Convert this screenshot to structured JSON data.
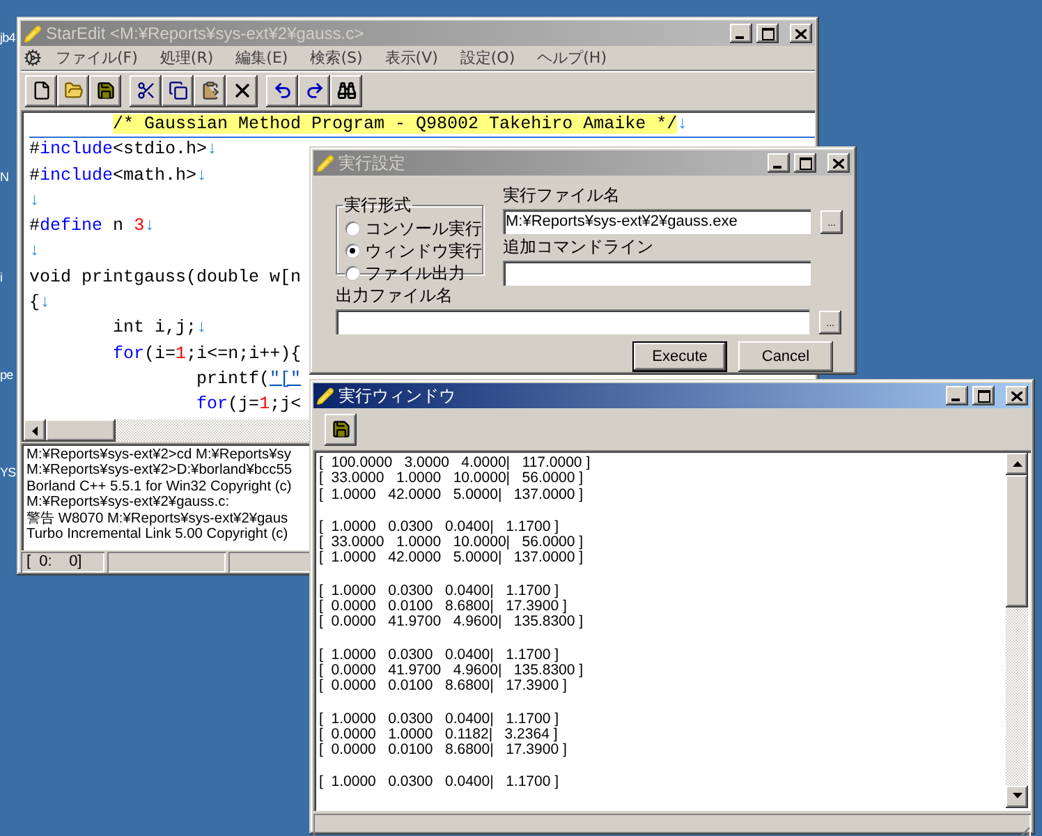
{
  "desktop": {
    "icon_labels": [
      "jb4",
      "N",
      "i",
      "pe",
      "YS"
    ]
  },
  "editor_window": {
    "title": "StarEdit <M:¥Reports¥sys-ext¥2¥gauss.c>",
    "active": false,
    "menu": [
      "ファイル(F)",
      "処理(R)",
      "編集(E)",
      "検索(S)",
      "表示(V)",
      "設定(O)",
      "ヘルプ(H)"
    ],
    "code_lines": [
      {
        "current": true,
        "tokens": [
          {
            "kind": "comment",
            "text": "        /* Gaussian Method Program - Q98002 Takehiro Amaike */"
          },
          {
            "kind": "mark",
            "text": "↓"
          }
        ]
      },
      {
        "current": false,
        "tokens": [
          {
            "kind": "plain",
            "text": "#"
          },
          {
            "kind": "keyword",
            "text": "include"
          },
          {
            "kind": "plain",
            "text": "<stdio.h>"
          },
          {
            "kind": "mark",
            "text": "↓"
          }
        ]
      },
      {
        "current": false,
        "tokens": [
          {
            "kind": "plain",
            "text": "#"
          },
          {
            "kind": "keyword",
            "text": "include"
          },
          {
            "kind": "plain",
            "text": "<math.h>"
          },
          {
            "kind": "mark",
            "text": "↓"
          }
        ]
      },
      {
        "current": false,
        "tokens": [
          {
            "kind": "mark",
            "text": "↓"
          }
        ]
      },
      {
        "current": false,
        "tokens": [
          {
            "kind": "plain",
            "text": "#"
          },
          {
            "kind": "keyword",
            "text": "define"
          },
          {
            "kind": "plain",
            "text": " n "
          },
          {
            "kind": "number",
            "text": "3"
          },
          {
            "kind": "mark",
            "text": "↓"
          }
        ]
      },
      {
        "current": false,
        "tokens": [
          {
            "kind": "mark",
            "text": "↓"
          }
        ]
      },
      {
        "current": false,
        "tokens": [
          {
            "kind": "plain",
            "text": "void printgauss(double w[n"
          }
        ]
      },
      {
        "current": false,
        "tokens": [
          {
            "kind": "plain",
            "text": "{"
          },
          {
            "kind": "mark",
            "text": "↓"
          }
        ]
      },
      {
        "current": false,
        "tokens": [
          {
            "kind": "plain",
            "text": "        int i,j;"
          },
          {
            "kind": "mark",
            "text": "↓"
          }
        ]
      },
      {
        "current": false,
        "tokens": [
          {
            "kind": "keyword",
            "text": "        for"
          },
          {
            "kind": "plain",
            "text": "(i="
          },
          {
            "kind": "number",
            "text": "1"
          },
          {
            "kind": "plain",
            "text": ";i<=n;i++){"
          }
        ]
      },
      {
        "current": false,
        "tokens": [
          {
            "kind": "plain",
            "text": "                printf("
          },
          {
            "kind": "string",
            "text": "\"[\""
          }
        ]
      },
      {
        "current": false,
        "tokens": [
          {
            "kind": "keyword",
            "text": "                for"
          },
          {
            "kind": "plain",
            "text": "(j="
          },
          {
            "kind": "number",
            "text": "1"
          },
          {
            "kind": "plain",
            "text": ";j<"
          }
        ]
      }
    ],
    "log_lines": [
      "M:¥Reports¥sys-ext¥2>cd M:¥Reports¥sy",
      "M:¥Reports¥sys-ext¥2>D:¥borland¥bcc55",
      "Borland C++ 5.5.1 for Win32 Copyright (c)",
      "M:¥Reports¥sys-ext¥2¥gauss.c:",
      "警告 W8070 M:¥Reports¥sys-ext¥2¥gaus",
      "Turbo Incremental Link 5.00 Copyright (c)"
    ],
    "status": "[  0:    0]"
  },
  "settings_dialog": {
    "title": "実行設定",
    "active": false,
    "mode_group": {
      "label": "実行形式",
      "options": [
        {
          "label": "コンソール実行",
          "selected": false
        },
        {
          "label": "ウィンドウ実行",
          "selected": true
        },
        {
          "label": "ファイル出力",
          "selected": false
        }
      ]
    },
    "exe_label": "実行ファイル名",
    "exe_value": "M:¥Reports¥sys-ext¥2¥gauss.exe",
    "exe_browse": "...",
    "args_label": "追加コマンドライン",
    "output_label": "出力ファイル名",
    "output_browse": "...",
    "buttons": [
      "Execute",
      "Cancel"
    ]
  },
  "output_window": {
    "title": "実行ウィンドウ",
    "active": true,
    "blocks": [
      [
        "[  100.0000   3.0000   4.0000|   117.0000 ]",
        "[  33.0000   1.0000   10.0000|   56.0000 ]",
        "[  1.0000   42.0000   5.0000|   137.0000 ]"
      ],
      [
        "[  1.0000   0.0300   0.0400|   1.1700 ]",
        "[  33.0000   1.0000   10.0000|   56.0000 ]",
        "[  1.0000   42.0000   5.0000|   137.0000 ]"
      ],
      [
        "[  1.0000   0.0300   0.0400|   1.1700 ]",
        "[  0.0000   0.0100   8.6800|   17.3900 ]",
        "[  0.0000   41.9700   4.9600|   135.8300 ]"
      ],
      [
        "[  1.0000   0.0300   0.0400|   1.1700 ]",
        "[  0.0000   41.9700   4.9600|   135.8300 ]",
        "[  0.0000   0.0100   8.6800|   17.3900 ]"
      ],
      [
        "[  1.0000   0.0300   0.0400|   1.1700 ]",
        "[  0.0000   1.0000   0.1182|   3.2364 ]",
        "[  0.0000   0.0100   8.6800|   17.3900 ]"
      ],
      [
        "[  1.0000   0.0300   0.0400|   1.1700 ]"
      ]
    ]
  }
}
